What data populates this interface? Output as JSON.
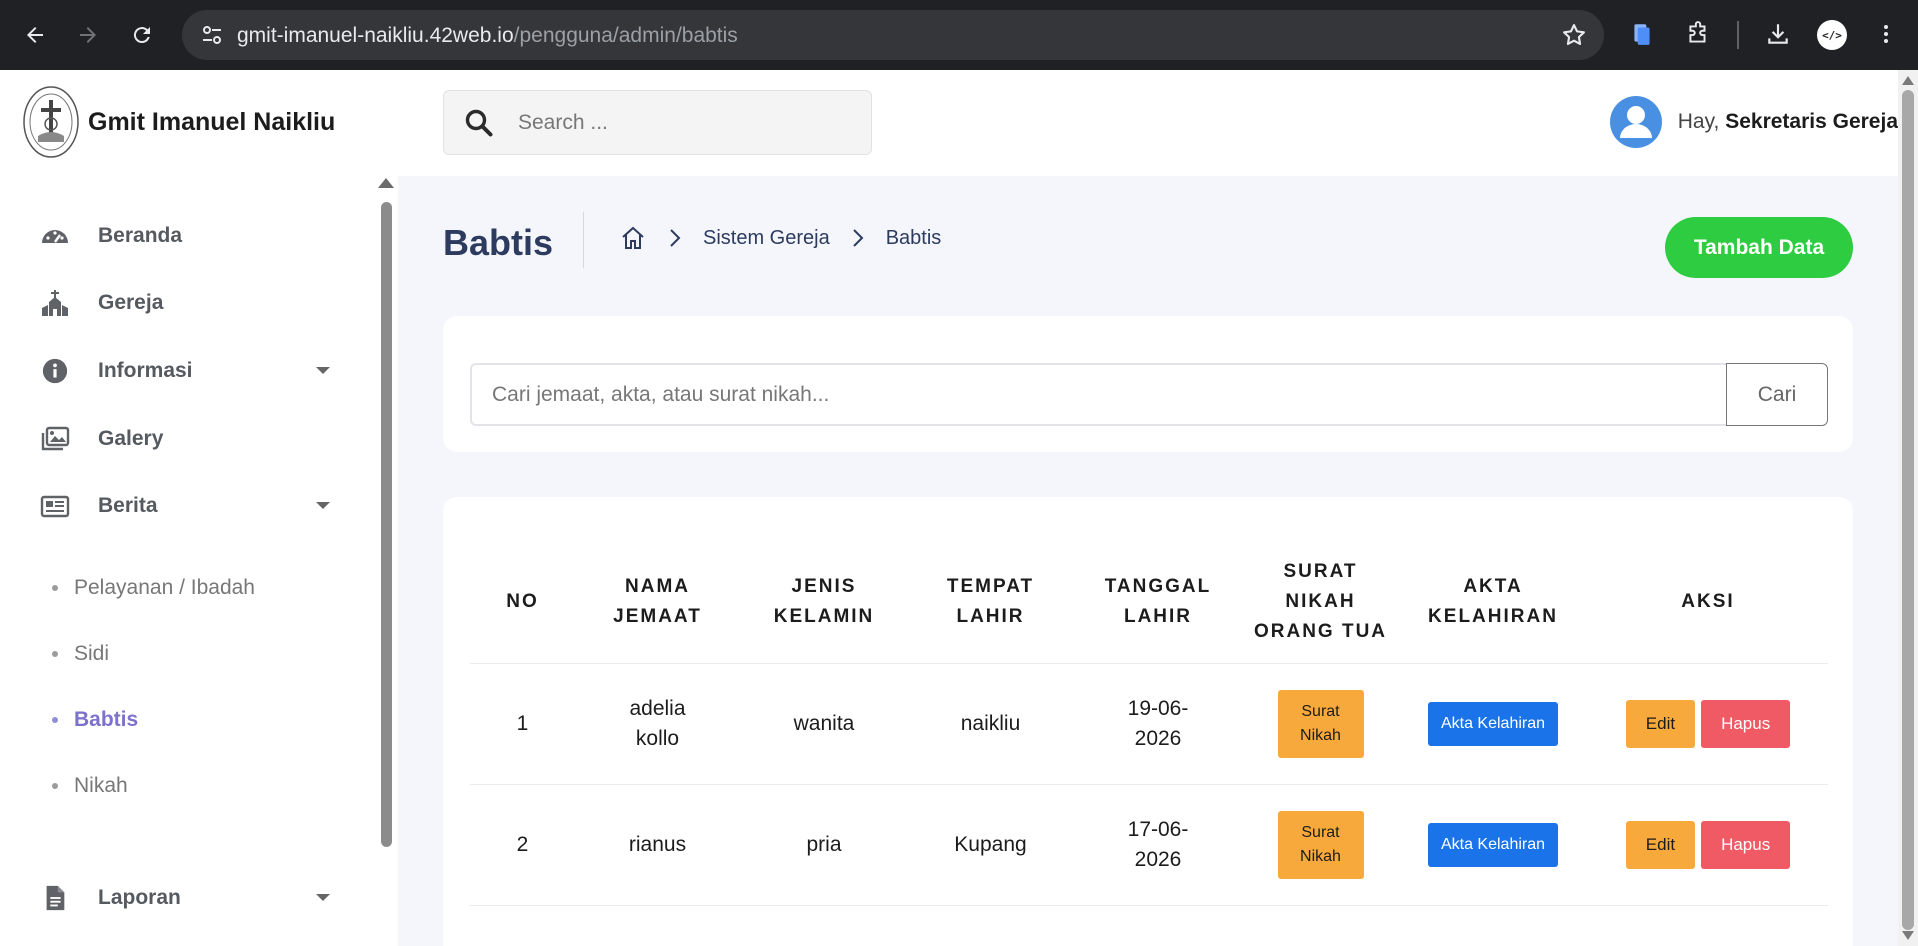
{
  "browser": {
    "url_host": "gmit-imanuel-naikliu.42web.io",
    "url_path": "/pengguna/admin/babtis",
    "profile_initials": "</>"
  },
  "brand": {
    "name": "Gmit Imanuel Naikliu"
  },
  "topbar": {
    "search_placeholder": "Search ...",
    "greeting": "Hay,",
    "user_name": "Sekretaris Gereja"
  },
  "sidebar": {
    "items": [
      {
        "label": "Beranda",
        "icon": "gauge-icon"
      },
      {
        "label": "Gereja",
        "icon": "church-icon"
      },
      {
        "label": "Informasi",
        "icon": "info-icon"
      },
      {
        "label": "Galery",
        "icon": "images-icon"
      },
      {
        "label": "Berita",
        "icon": "newspaper-icon"
      },
      {
        "label": "Laporan",
        "icon": "file-icon"
      }
    ],
    "sub_items": [
      {
        "label": "Pelayanan / Ibadah"
      },
      {
        "label": "Sidi"
      },
      {
        "label": "Babtis",
        "active": true
      },
      {
        "label": "Nikah"
      }
    ]
  },
  "page": {
    "title": "Babtis",
    "breadcrumb": [
      "Sistem Gereja",
      "Babtis"
    ],
    "add_button": "Tambah Data"
  },
  "filter": {
    "placeholder": "Cari jemaat, akta, atau surat nikah...",
    "button": "Cari"
  },
  "table": {
    "headers": [
      "NO",
      "NAMA JEMAAT",
      "JENIS KELAMIN",
      "TEMPAT LAHIR",
      "TANGGAL LAHIR",
      "SURAT NIKAH ORANG TUA",
      "AKTA KELAHIRAN",
      "AKSI"
    ],
    "rows": [
      {
        "no": "1",
        "nama": "adelia kollo",
        "jenis_kelamin": "wanita",
        "tempat_lahir": "naikliu",
        "tanggal_lahir": "19-06-2026",
        "surat_nikah": "Surat Nikah",
        "akta": "Akta Kelahiran",
        "edit": "Edit",
        "hapus": "Hapus"
      },
      {
        "no": "2",
        "nama": "rianus",
        "jenis_kelamin": "pria",
        "tempat_lahir": "Kupang",
        "tanggal_lahir": "17-06-2026",
        "surat_nikah": "Surat Nikah",
        "akta": "Akta Kelahiran",
        "edit": "Edit",
        "hapus": "Hapus"
      }
    ]
  },
  "colors": {
    "accent_green": "#2ecc40",
    "title_navy": "#2c3b5e",
    "active_purple": "#7c72cc",
    "btn_orange": "#f7a93b",
    "btn_blue": "#1a73e8",
    "btn_red": "#ef5a64"
  }
}
